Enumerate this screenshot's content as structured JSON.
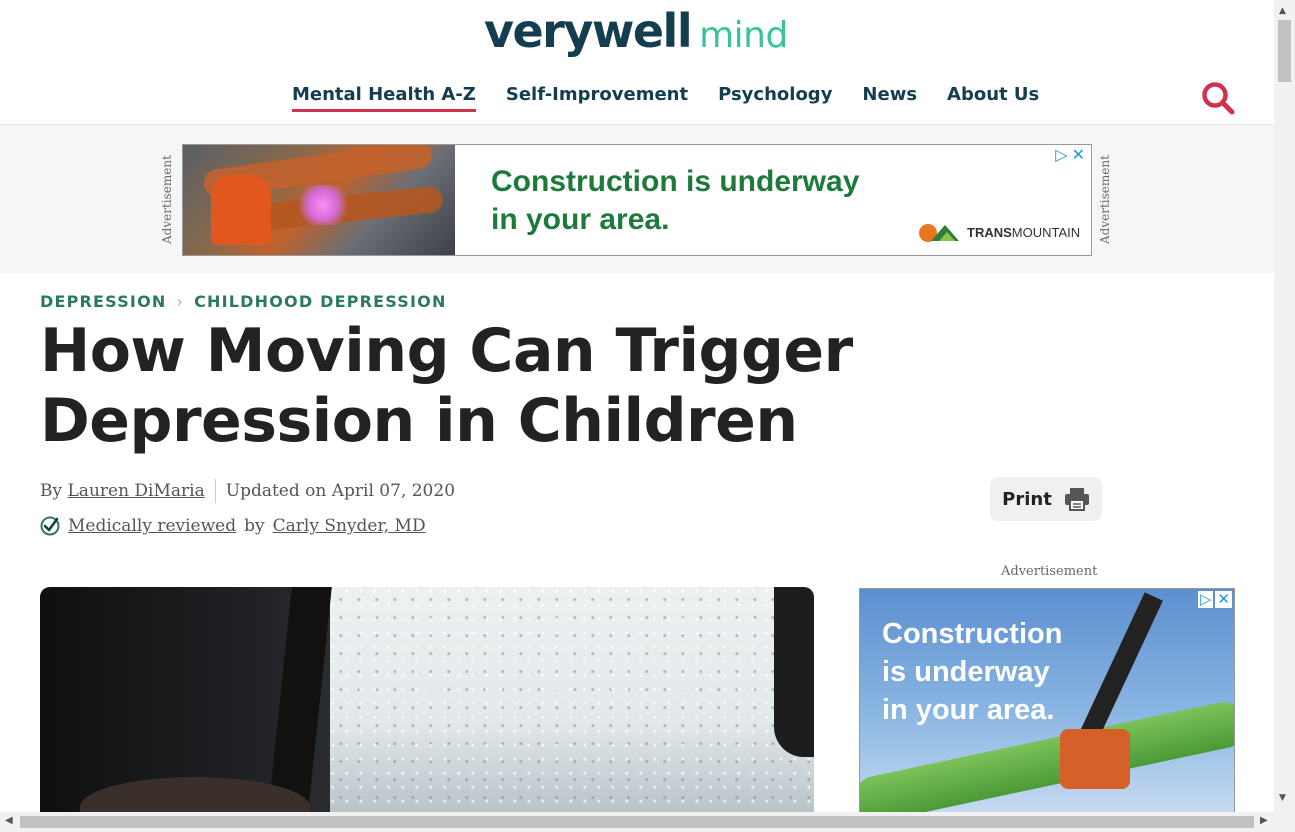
{
  "brand": {
    "name": "verywell",
    "sub": "mind"
  },
  "nav": {
    "items": [
      {
        "label": "Mental Health A-Z",
        "active": true
      },
      {
        "label": "Self-Improvement"
      },
      {
        "label": "Psychology"
      },
      {
        "label": "News"
      },
      {
        "label": "About Us"
      }
    ],
    "search_icon": "search-icon"
  },
  "ad_top": {
    "label": "Advertisement",
    "headline_line1": "Construction is underway",
    "headline_line2": "in your area.",
    "brand_bold": "TRANS",
    "brand_rest": "MOUNTAIN",
    "choices": [
      "▷",
      "✕"
    ]
  },
  "breadcrumb": [
    "DEPRESSION",
    "CHILDHOOD DEPRESSION"
  ],
  "article": {
    "title": "How Moving Can Trigger Depression in Children",
    "by_prefix": "By",
    "author": "Lauren DiMaria",
    "updated": "Updated on April 07, 2020",
    "reviewed_link": "Medically reviewed",
    "reviewed_by": "by",
    "reviewer": "Carly Snyder, MD",
    "print_label": "Print"
  },
  "ad_side": {
    "label": "Advertisement",
    "headline_line1": "Construction",
    "headline_line2": "is underway",
    "headline_line3": "in your area.",
    "choices": [
      "▷",
      "✕"
    ]
  },
  "colors": {
    "brand_dark": "#143d4f",
    "brand_green": "#3cc29a",
    "accent_red": "#d2314e",
    "breadcrumb_green": "#2a7a5f",
    "ad_green": "#1d7a3b"
  }
}
